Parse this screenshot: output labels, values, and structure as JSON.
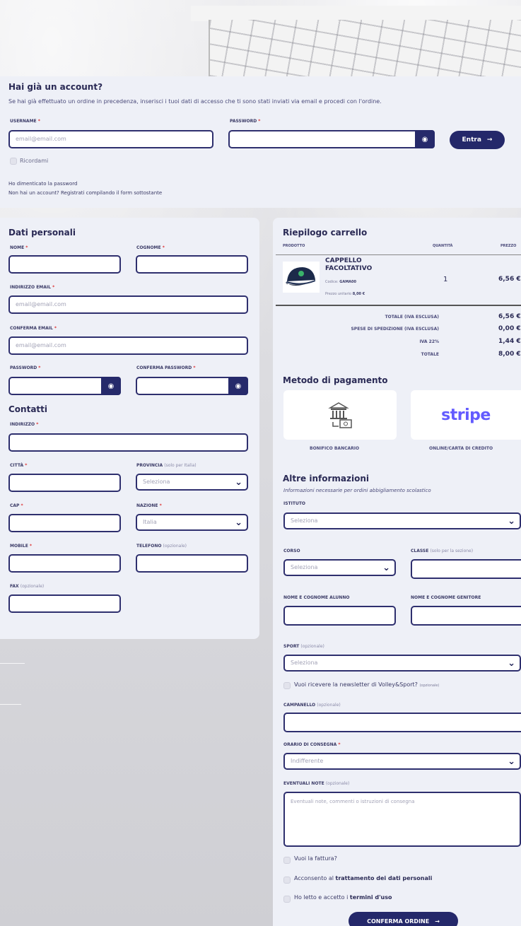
{
  "login": {
    "title": "Hai già un account?",
    "desc": "Se hai già effettuato un ordine in precedenza, inserisci i tuoi dati di accesso che ti sono stati inviati via email e procedi con l'ordine.",
    "email_label": "Username",
    "email_placeholder": "email@email.com",
    "password_label": "Password",
    "entra_label": "Entra",
    "remember_label": "Ricordami",
    "forgot_label": "Ho dimenticato la password",
    "no_account_label": "Non hai un account? Registrati compilando il form sottostante"
  },
  "personal": {
    "title": "Dati personali",
    "nome_label": "Nome",
    "cognome_label": "Cognome",
    "email_label": "Indirizzo email",
    "email_placeholder": "email@email.com",
    "confirm_email_label": "Conferma email",
    "confirm_email_placeholder": "email@email.com",
    "password_label": "Password",
    "confirm_password_label": "Conferma password"
  },
  "contacts": {
    "title": "Contatti",
    "address_label": "Indirizzo",
    "city_label": "Città",
    "province_label": "Provincia",
    "province_optional": "(solo per Italia)",
    "province_value": "Seleziona",
    "cap_label": "Cap",
    "country_label": "Nazione",
    "country_value": "Italia",
    "mobile_label": "Mobile",
    "phone_label": "Telefono",
    "phone_optional": "(opzionale)",
    "fax_label": "Fax",
    "fax_optional": "(opzionale)"
  },
  "cart": {
    "title": "Riepilogo carrello",
    "col_product": "Prodotto",
    "col_qty": "Quantità",
    "col_price": "Prezzo",
    "product_name": "CAPPELLO FACOLTATIVO",
    "product_code_label": "Codice:",
    "product_code": "GAMA00",
    "product_unit_label": "Prezzo unitario",
    "product_unit": "8,00 €",
    "qty": "1",
    "price": "6,56 €",
    "totals": [
      {
        "label": "Totale (IVA esclusa)",
        "value": "6,56 €"
      },
      {
        "label": "Spese di spedizione (IVA esclusa)",
        "value": "0,00 €"
      },
      {
        "label": "IVA 22%",
        "value": "1,44 €"
      },
      {
        "label": "Totale",
        "value": "8,00 €"
      }
    ]
  },
  "payment": {
    "title": "Metodo di pagamento",
    "bank_label": "Bonifico bancario",
    "card_label": "Online/carta di credito",
    "stripe_text": "stripe"
  },
  "other": {
    "title": "Altre informazioni",
    "note": "Informazioni necessarie per ordini abbigliamento scolastico",
    "istituto_label": "Istituto",
    "istituto_value": "Seleziona",
    "corso_label": "Corso",
    "corso_value": "Seleziona",
    "classe_label": "Classe",
    "classe_optional": "(solo per la sezione)",
    "alunno_label": "Nome e cognome alunno",
    "genitore_label": "Nome e cognome genitore",
    "sport_label": "Sport",
    "sport_optional": "(opzionale)",
    "sport_value": "Seleziona",
    "newsletter_label": "Vuoi ricevere la newsletter di Volley&Sport?",
    "newsletter_optional": "(opzionale)",
    "campanello_label": "Campanello",
    "campanello_optional": "(opzionale)",
    "orario_label": "Orario di consegna",
    "orario_value": "Indifferente",
    "note_label": "Eventuali note",
    "note_optional": "(opzionale)",
    "note_placeholder": "Eventuali note, commenti o istruzioni di consegna",
    "fattura_label": "Vuoi la fattura?",
    "privacy_prefix": "Acconsento al",
    "privacy_bold": "trattamento dei dati personali",
    "terms_prefix": "Ho letto e accetto i",
    "terms_bold": "termini d'uso",
    "confirm_label": "Conferma ordine"
  },
  "icons": {
    "eye": "eye-icon",
    "arrow": "arrow-right-icon",
    "chevron": "chevron-down-icon",
    "bank": "bank-transfer-icon"
  }
}
